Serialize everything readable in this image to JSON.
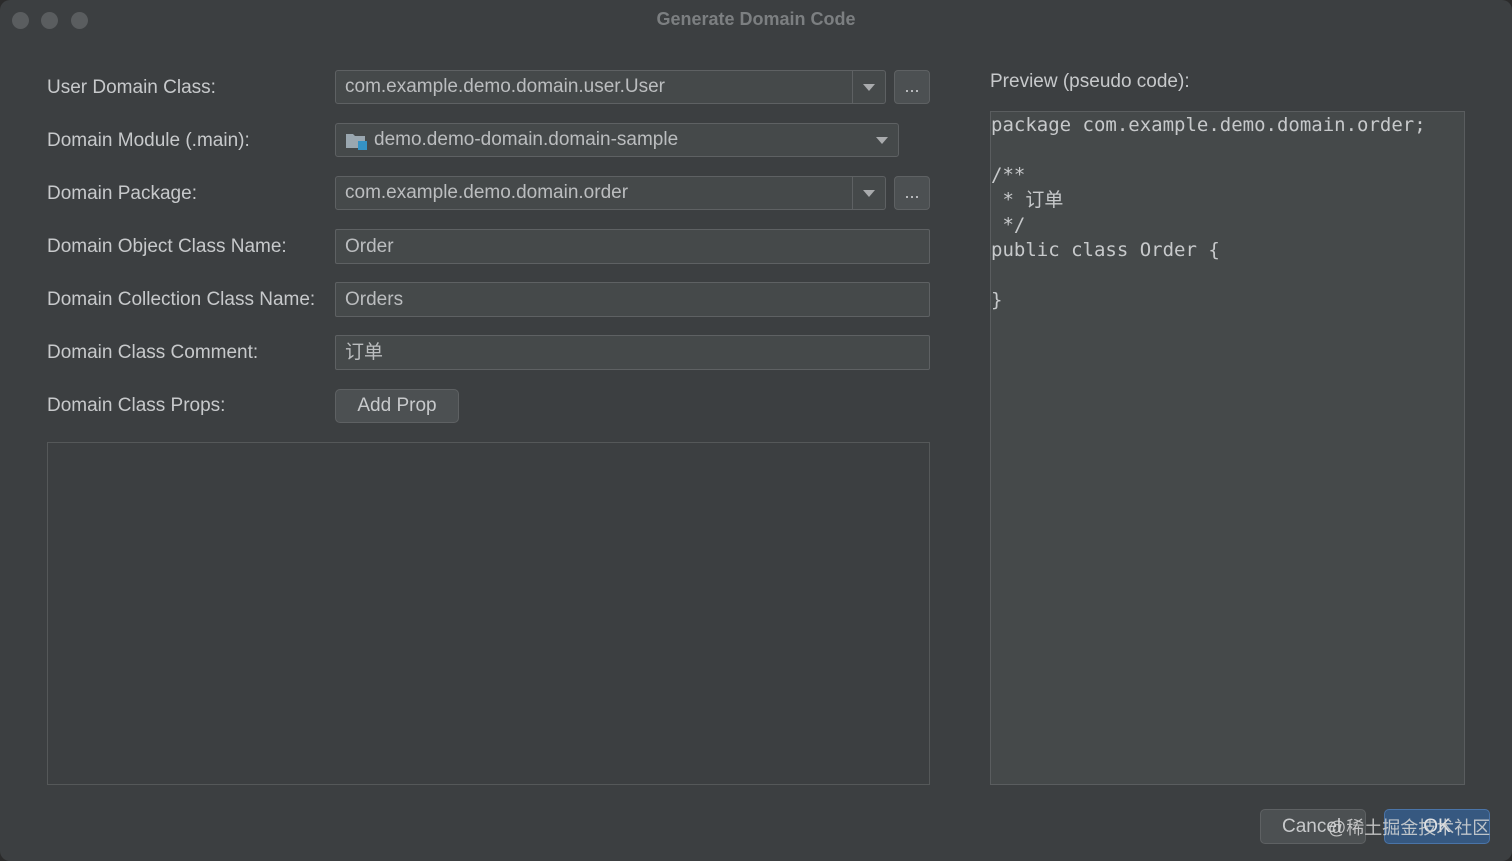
{
  "window": {
    "title": "Generate Domain Code"
  },
  "form": {
    "user_domain_class": {
      "label": "User Domain Class:",
      "value": "com.example.demo.domain.user.User",
      "browse_label": "..."
    },
    "domain_module": {
      "label": "Domain Module (.main):",
      "value": "demo.demo-domain.domain-sample",
      "icon": "module-folder-icon"
    },
    "domain_package": {
      "label": "Domain Package:",
      "value": "com.example.demo.domain.order",
      "browse_label": "..."
    },
    "domain_object_class_name": {
      "label": "Domain Object Class Name:",
      "value": "Order"
    },
    "domain_collection_class_name": {
      "label": "Domain Collection Class Name:",
      "value": "Orders"
    },
    "domain_class_comment": {
      "label": "Domain Class Comment:",
      "value": "订单"
    },
    "domain_class_props": {
      "label": "Domain Class Props:",
      "add_button": "Add Prop"
    }
  },
  "preview": {
    "label": "Preview (pseudo code):",
    "code": "package com.example.demo.domain.order;\n\n/**\n * 订单\n */\npublic class Order {\n\n}"
  },
  "footer": {
    "cancel_label": "Cancel",
    "ok_label": "OK"
  },
  "watermark": "@稀土掘金技术社区",
  "colors": {
    "background": "#3c3f41",
    "field": "#45494a",
    "border": "#5e6163",
    "text": "#c7c9cb",
    "accent": "#365880"
  }
}
